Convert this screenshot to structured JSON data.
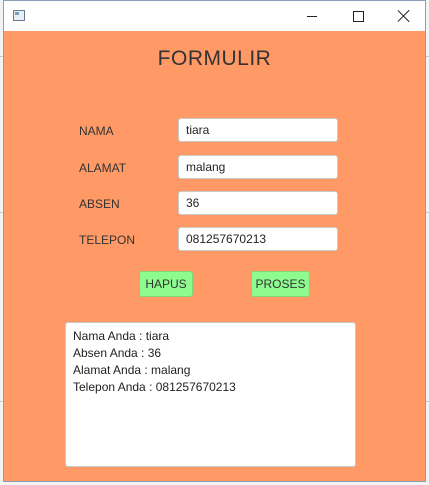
{
  "window": {
    "background": "#ff9966"
  },
  "form": {
    "title": "FORMULIR",
    "fields": [
      {
        "label": "NAMA",
        "value": "tiara"
      },
      {
        "label": "ALAMAT",
        "value": "malang"
      },
      {
        "label": "ABSEN",
        "value": "36"
      },
      {
        "label": "TELEPON",
        "value": "081257670213"
      }
    ],
    "buttons": {
      "hapus": "HAPUS",
      "proses": "PROSES"
    },
    "button_color": "#8dfb8d",
    "output": [
      "Nama Anda : tiara",
      "Absen Anda : 36",
      "Alamat Anda : malang",
      "Telepon Anda : 081257670213"
    ]
  }
}
